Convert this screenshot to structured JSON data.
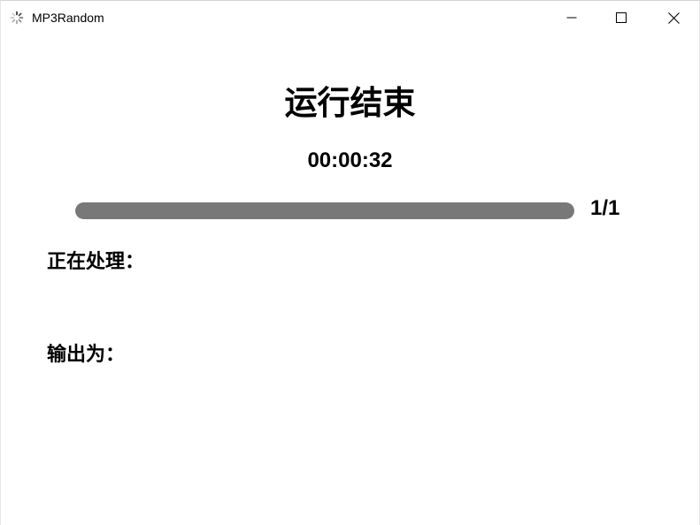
{
  "window": {
    "title": "MP3Random",
    "icon": "loading-spinner-icon"
  },
  "controls": {
    "minimize_icon": "minimize-icon",
    "maximize_icon": "maximize-icon",
    "close_icon": "close-icon"
  },
  "status": {
    "title": "运行结束",
    "elapsed": "00:00:32"
  },
  "progress": {
    "fraction": 1.0,
    "count_label": "1/1",
    "fill_color": "#787878"
  },
  "details": {
    "processing_label": "正在处理：",
    "processing_value": "",
    "output_label": "输出为：",
    "output_value": ""
  }
}
